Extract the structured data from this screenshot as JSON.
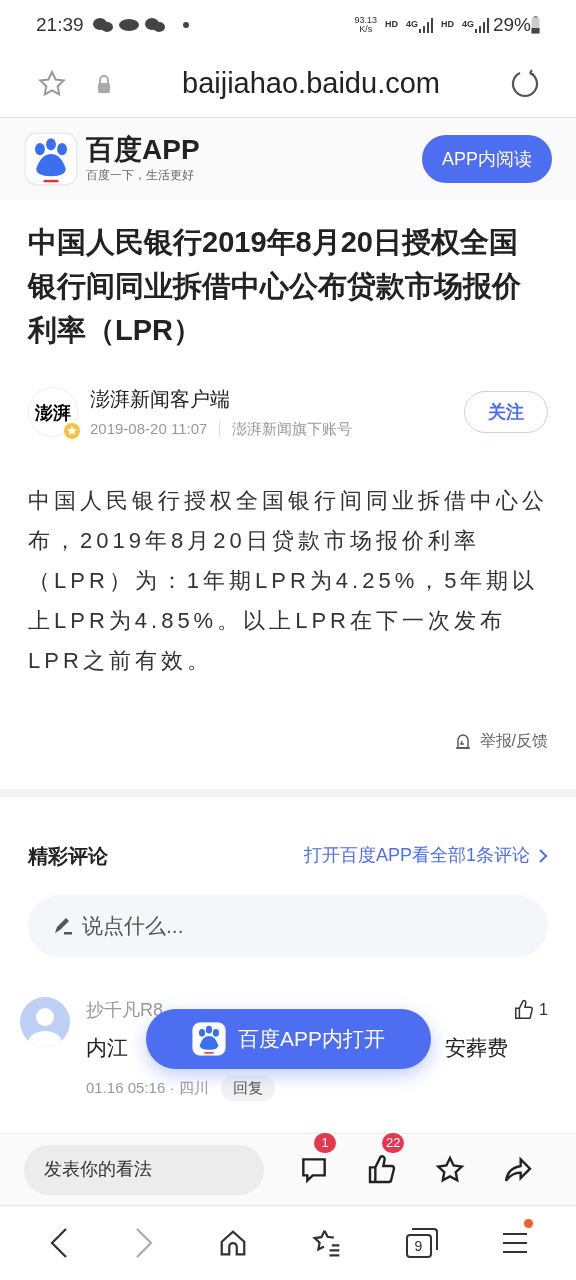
{
  "status_bar": {
    "time": "21:39",
    "speed_value": "93.13",
    "speed_unit": "K/s",
    "labels": [
      "HD",
      "4G",
      "HD",
      "4G"
    ],
    "battery": "29%"
  },
  "address_bar": {
    "url": "baijiahao.baidu.com"
  },
  "app_banner": {
    "name": "百度APP",
    "slogan": "百度一下，生活更好",
    "button": "APP内阅读"
  },
  "article": {
    "title": "中国人民银行2019年8月20日授权全国银行间同业拆借中心公布贷款市场报价利率（LPR）",
    "author": {
      "name": "澎湃新闻客户端",
      "logo": "澎湃",
      "date": "2019-08-20 11:07",
      "source": "澎湃新闻旗下账号",
      "verified": true
    },
    "follow_button": "关注",
    "body": "中国人民银行授权全国银行间同业拆借中心公布，2019年8月20日贷款市场报价利率（LPR）为：1年期LPR为4.25%，5年期以上LPR为4.85%。以上LPR在下一次发布LPR之前有效。",
    "report": "举报/反馈"
  },
  "comments": {
    "heading": "精彩评论",
    "link": "打开百度APP看全部1条评论",
    "input": {
      "placeholder": "说点什么..."
    },
    "items": [
      {
        "user": "抄千凡R8",
        "text_start": "内江",
        "text_end": "安葬费",
        "likes": "1",
        "meta": "01.16 05:16 · 四川",
        "reply": "回复"
      }
    ]
  },
  "float_button": "百度APP内打开",
  "action_bar": {
    "input": {
      "placeholder": "发表你的看法"
    },
    "comment_badge": "1",
    "like_badge": "22"
  },
  "nav_bar": {
    "tab_count": "9",
    "menu_notification": true
  }
}
